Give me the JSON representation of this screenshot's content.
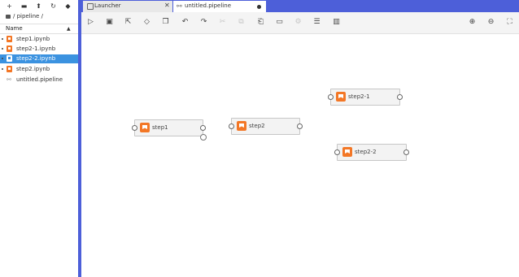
{
  "file_browser": {
    "toolbar_icons": [
      "new-launcher-icon",
      "new-folder-icon",
      "upload-icon",
      "refresh-icon",
      "git-icon"
    ],
    "breadcrumb": "/ pipeline /",
    "column_header": "Name",
    "files": [
      {
        "name": "step1.ipynb",
        "type": "notebook",
        "running": true,
        "selected": false
      },
      {
        "name": "step2-1.ipynb",
        "type": "notebook",
        "running": true,
        "selected": false
      },
      {
        "name": "step2-2.ipynb",
        "type": "notebook",
        "running": true,
        "selected": true
      },
      {
        "name": "step2.ipynb",
        "type": "notebook",
        "running": true,
        "selected": false
      },
      {
        "name": "untitled.pipeline",
        "type": "pipeline",
        "running": false,
        "selected": false
      }
    ]
  },
  "tabs": [
    {
      "label": "Launcher",
      "icon": "launcher-icon",
      "active": false,
      "close": "✕"
    },
    {
      "label": "untitled.pipeline",
      "icon": "pipeline-icon",
      "active": true,
      "unsaved": true
    }
  ],
  "pipeline_toolbar": [
    {
      "icon": "run-icon",
      "glyph": "▷",
      "enabled": true
    },
    {
      "icon": "save-icon",
      "glyph": "🖫",
      "enabled": true
    },
    {
      "icon": "export-icon",
      "glyph": "⎘",
      "enabled": true
    },
    {
      "icon": "clear-icon",
      "glyph": "⌫",
      "enabled": true
    },
    {
      "icon": "open-runtimes-icon",
      "glyph": "⚙",
      "enabled": true
    },
    {
      "icon": "undo-icon",
      "glyph": "↶",
      "enabled": true
    },
    {
      "icon": "redo-icon",
      "glyph": "↷",
      "enabled": true
    },
    {
      "icon": "cut-icon",
      "glyph": "✂",
      "enabled": false
    },
    {
      "icon": "copy-icon",
      "glyph": "⧉",
      "enabled": false
    },
    {
      "icon": "paste-icon",
      "glyph": "📋",
      "enabled": true
    },
    {
      "icon": "add-comment-icon",
      "glyph": "💬",
      "enabled": true
    },
    {
      "icon": "delete-icon",
      "glyph": "🗑",
      "enabled": false
    },
    {
      "icon": "arrange-horizontal-icon",
      "glyph": "⊟",
      "enabled": true
    },
    {
      "icon": "arrange-vertical-icon",
      "glyph": "▥",
      "enabled": true
    },
    {
      "icon": "zoom-in-icon",
      "glyph": "⊕",
      "enabled": true
    },
    {
      "icon": "zoom-out-icon",
      "glyph": "⊖",
      "enabled": true
    },
    {
      "icon": "zoom-to-fit-icon",
      "glyph": "⛶",
      "enabled": true
    }
  ],
  "canvas": {
    "nodes": [
      {
        "label": "step1"
      },
      {
        "label": "step2"
      },
      {
        "label": "step2-1"
      },
      {
        "label": "step2-2"
      }
    ]
  },
  "colors": {
    "accent": "#4d5fd9",
    "notebook": "#f37726",
    "selection": "#3b92e0"
  }
}
